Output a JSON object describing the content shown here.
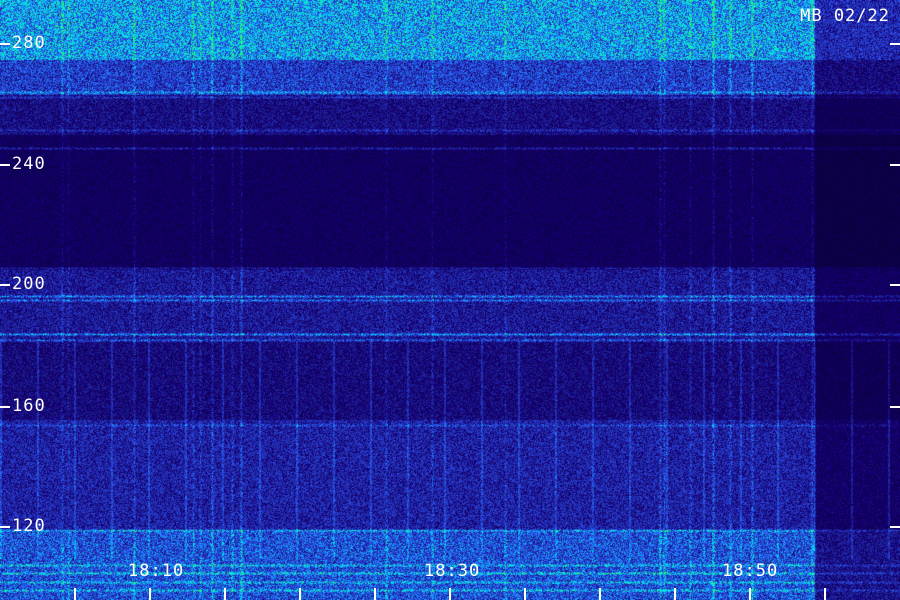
{
  "station_label": "MB 02/22",
  "y_axis": {
    "ticks": [
      {
        "value": 280,
        "label": "280"
      },
      {
        "value": 240,
        "label": "240"
      },
      {
        "value": 200,
        "label": "200"
      },
      {
        "value": 160,
        "label": "160"
      },
      {
        "value": 120,
        "label": "120"
      }
    ]
  },
  "x_axis": {
    "labels": [
      "18:10",
      "18:30",
      "18:50"
    ]
  },
  "colors": {
    "background": "#000000",
    "low": "#0a0a5a",
    "mid": "#1e30d8",
    "high": "#00e0ff",
    "peak": "#20ff60",
    "text": "#ffffff"
  }
}
